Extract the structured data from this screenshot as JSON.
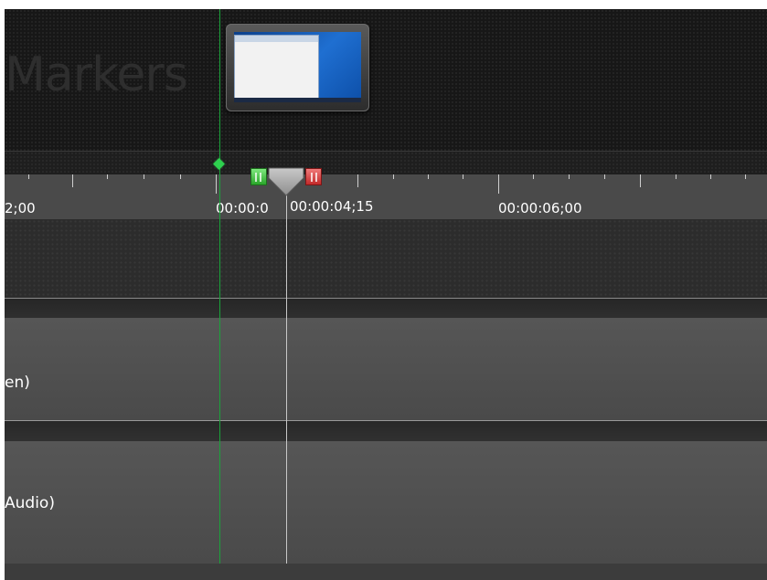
{
  "markers_panel": {
    "title": "Markers"
  },
  "ruler": {
    "tick_labels": [
      "2;00",
      "00:00:0",
      "00:00:04;15",
      "00:00:06;00"
    ]
  },
  "tracks": {
    "screen_label": "en)",
    "audio_label": "Audio)"
  },
  "colors": {
    "in_point": "#2aa52a",
    "out_point": "#c22a2a",
    "marker_line": "#1aa33a",
    "playhead": "#c8c8c8"
  },
  "icons": {
    "marker": "green-diamond-icon",
    "playhead": "playhead-handle-icon"
  }
}
